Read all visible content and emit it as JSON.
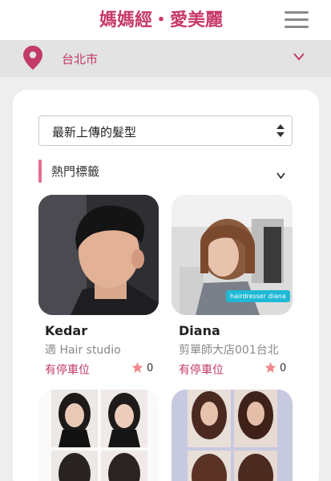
{
  "header": {
    "logo_text": "媽媽經・愛美麗"
  },
  "location": {
    "label": "台北市"
  },
  "sort_select": {
    "value": "最新上傳的髮型"
  },
  "tags": {
    "title": "熱門標籤"
  },
  "cards": [
    {
      "name": "Kedar",
      "salon": "適 Hair studio",
      "parking": "有停車位",
      "likes": "0"
    },
    {
      "name": "Diana",
      "salon": "剪單師大店001台北",
      "parking": "有停車位",
      "likes": "0",
      "badge": "hairdresser diana"
    }
  ],
  "colors": {
    "brand": "#c8396b",
    "accent_pink": "#e56d8f",
    "star": "#f08a8f",
    "badge": "#1fb9d6"
  }
}
